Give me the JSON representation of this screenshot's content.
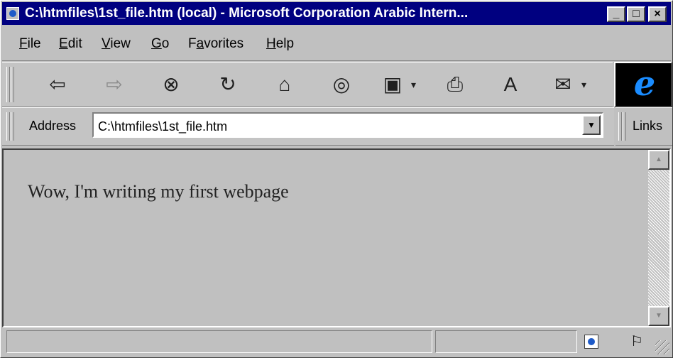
{
  "window": {
    "title": "C:\\htmfiles\\1st_file.htm (local) - Microsoft Corporation Arabic Intern...",
    "controls": {
      "minimize": "_",
      "maximize": "□",
      "close": "×"
    }
  },
  "menu": {
    "items": [
      {
        "label": "File",
        "accel": "F",
        "rest": "ile"
      },
      {
        "label": "Edit",
        "accel": "E",
        "rest": "dit"
      },
      {
        "label": "View",
        "accel": "V",
        "rest": "iew"
      },
      {
        "label": "Go",
        "accel": "G",
        "rest": "o"
      },
      {
        "label": "Favorites",
        "pre": "F",
        "accel": "a",
        "rest": "vorites"
      },
      {
        "label": "Help",
        "accel": "H",
        "rest": "elp"
      }
    ]
  },
  "toolbar": {
    "icons": {
      "back": "⇦",
      "forward": "⇨",
      "stop": "⊗",
      "refresh": "↻",
      "home": "⌂",
      "search": "◎",
      "favorites": "▣",
      "print": "⎙",
      "font": "A",
      "mail": "✉",
      "dropdown": "▾"
    }
  },
  "address": {
    "label": "Address",
    "value": "C:\\htmfiles\\1st_file.htm",
    "dropdown": "▼"
  },
  "links": {
    "label": "Links"
  },
  "page": {
    "text": "Wow, I'm writing my first webpage"
  },
  "scrollbar": {
    "up": "▲",
    "down": "▼"
  },
  "status": {
    "text": ""
  },
  "colors": {
    "titlebar": "#000080",
    "face": "#c0c0c0",
    "ie_logo": "#1a8cff"
  }
}
